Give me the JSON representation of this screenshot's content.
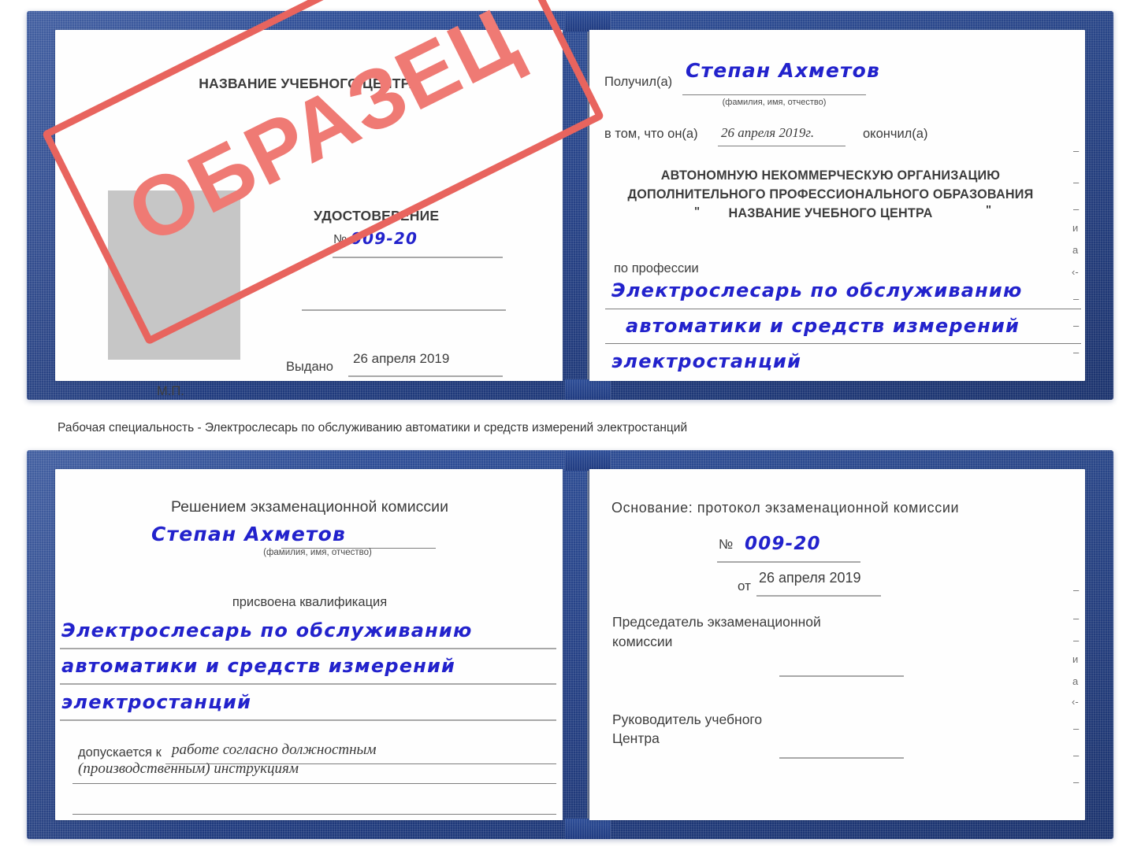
{
  "caption": {
    "text": "Рабочая специальность - Электрослесарь по обслуживанию автоматики и средств измерений электростанций"
  },
  "stamp": {
    "label": "ОБРАЗЕЦ",
    "color": "#ef7a74",
    "border_color": "#e8645e"
  },
  "colors": {
    "cover_blue": "#2d4d96",
    "ink_blue": "#2222cc",
    "print_gray": "#3c3c3c",
    "rule_gray": "#a8a8a8",
    "photo_gray": "#c6c6c6"
  },
  "certificate_top": {
    "left_page": {
      "heading": "НАЗВАНИЕ УЧЕБНОГО ЦЕНТРА",
      "title": "УДОСТОВЕРЕНИЕ",
      "number_label": "№",
      "number_value": "009-20",
      "issued_label": "Выдано",
      "issued_value": "26 апреля 2019",
      "seal_label": "М.П.",
      "photo_placeholder": "photo-placeholder"
    },
    "right_page": {
      "received_label": "Получил(а)",
      "received_value": "Степан Ахметов",
      "received_hint": "(фамилия, имя, отчество)",
      "in_that_label": "в том, что он(а)",
      "in_that_value": "26 апреля 2019г.",
      "finished_label": "окончил(а)",
      "org_line1": "АВТОНОМНУЮ НЕКОММЕРЧЕСКУЮ ОРГАНИЗАЦИЮ",
      "org_line2": "ДОПОЛНИТЕЛЬНОГО ПРОФЕССИОНАЛЬНОГО ОБРАЗОВАНИЯ",
      "org_quote_open": "\"",
      "org_line3": "НАЗВАНИЕ УЧЕБНОГО ЦЕНТРА",
      "org_quote_close": "\"",
      "profession_label": "по профессии",
      "profession_line1": "Электрослесарь по обслуживанию",
      "profession_line2": "автоматики и средств измерений",
      "profession_line3": "электростанций"
    },
    "edge_fragments": [
      "–",
      "–",
      "–",
      "и",
      "а",
      "‹-",
      "–",
      "–",
      "–"
    ]
  },
  "certificate_bottom": {
    "left_page": {
      "heading": "Решением экзаменационной комиссии",
      "name_value": "Степан Ахметов",
      "name_hint": "(фамилия, имя, отчество)",
      "qualification_label": "присвоена квалификация",
      "qualification_line1": "Электрослесарь по обслуживанию",
      "qualification_line2": "автоматики и средств измерений",
      "qualification_line3": "электростанций",
      "allowed_label": "допускается к",
      "allowed_value_line1": "работе согласно должностным",
      "allowed_value_line2": "(производственным) инструкциям"
    },
    "right_page": {
      "basis_label": "Основание: протокол экзаменационной комиссии",
      "number_label": "№",
      "number_value": "009-20",
      "date_label": "от",
      "date_value": "26 апреля 2019",
      "chairman_line1": "Председатель экзаменационной",
      "chairman_line2": "комиссии",
      "head_line1": "Руководитель учебного",
      "head_line2": "Центра"
    },
    "edge_fragments": [
      "–",
      "–",
      "–",
      "и",
      "а",
      "‹-",
      "–",
      "–",
      "–"
    ]
  }
}
